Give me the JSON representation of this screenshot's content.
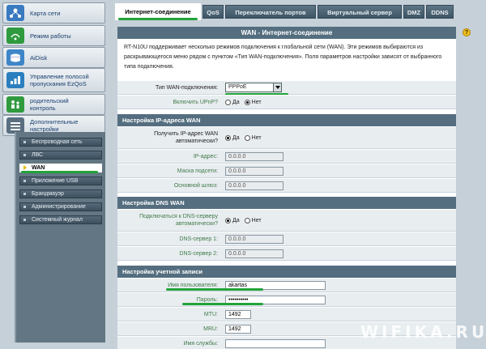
{
  "sidebar": {
    "items": [
      {
        "label": "Карта сети",
        "icon": "network-map-icon",
        "color": "#3a7ac0"
      },
      {
        "label": "Режим работы",
        "icon": "wireless-mode-icon",
        "color": "#2f9a3e"
      },
      {
        "label": "AiDisk",
        "icon": "aidisk-icon",
        "color": "#3f86c8"
      },
      {
        "label": "Управление полосой пропускания EzQoS",
        "icon": "ezqos-icon",
        "color": "#2c7fbf"
      },
      {
        "label": "родительский контроль",
        "icon": "parental-control-icon",
        "color": "#2f9a3e"
      },
      {
        "label": "Дополнительные настройки",
        "icon": "advanced-settings-icon",
        "color": "#5a6f80"
      }
    ],
    "submenu": [
      {
        "label": "Беспроводная сеть"
      },
      {
        "label": "ЛВС"
      },
      {
        "label": "WAN",
        "active": true
      },
      {
        "label": "Приложение USB"
      },
      {
        "label": "Брандмауэр"
      },
      {
        "label": "Администрирование"
      },
      {
        "label": "Системный журнал"
      }
    ]
  },
  "tabs": [
    {
      "label": "Интернет-соединение",
      "active": true
    },
    {
      "label": "QoS"
    },
    {
      "label": "Переключатель портов"
    },
    {
      "label": "Виртуальный сервер"
    },
    {
      "label": "DMZ"
    },
    {
      "label": "DDNS"
    }
  ],
  "page": {
    "title": "WAN - Интернет-соединение",
    "description": "RT-N10U поддерживает несколько режимов подключения к глобальной сети (WAN). Эти режимов выбираются из раскрывающегося меню рядом с пунктом «Тип WAN-подключения». Поля параметров настройки зависят от выбранного типа подключения.",
    "help_icon": "?"
  },
  "wan_type": {
    "label": "Тип WAN-подключения:",
    "value": "PPPoE"
  },
  "upnp": {
    "label": "Включить UPnP?",
    "options": [
      "Да",
      "Нет"
    ],
    "selected": "Нет"
  },
  "ip_section": {
    "title": "Настройка IP-адреса WAN",
    "auto_label": "Получить IP-адрес WAN автоматически?",
    "options": [
      "Да",
      "Нет"
    ],
    "selected": "Да",
    "ip_label": "IP-адрес:",
    "ip_value": "0.0.0.0",
    "mask_label": "Маска подсети:",
    "mask_value": "0.0.0.0",
    "gw_label": "Основной шлюз:",
    "gw_value": "0.0.0.0"
  },
  "dns_section": {
    "title": "Настройка DNS WAN",
    "auto_label": "Подключаться к DNS-серверу автоматически?",
    "options": [
      "Да",
      "Нет"
    ],
    "selected": "Да",
    "dns1_label": "DNS-сервер 1:",
    "dns1_value": "0.0.0.0",
    "dns2_label": "DNS-сервер 2:",
    "dns2_value": "0.0.0.0"
  },
  "account_section": {
    "title": "Настройка учетной записи",
    "user_label": "Имя пользователя:",
    "user_value": "akartas",
    "pass_label": "Пароль:",
    "pass_value": "••••••••••",
    "mtu_label": "MTU:",
    "mtu_value": "1492",
    "mru_label": "MRU:",
    "mru_value": "1492",
    "service_label": "Имя службы:",
    "service_value": ""
  },
  "watermark": "WIFIKA.RU",
  "colors": {
    "accent_green": "#22a33a",
    "header_blue": "#546e7f",
    "label_green": "#3f7a48"
  }
}
